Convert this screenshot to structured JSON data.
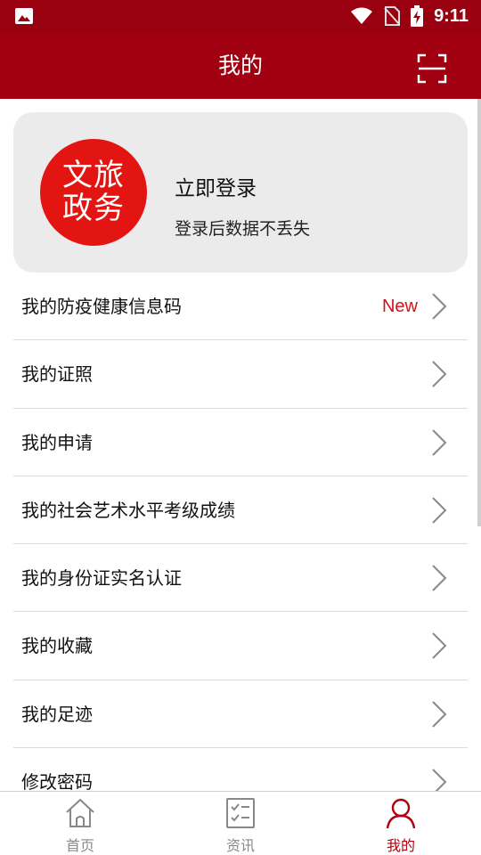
{
  "status_bar": {
    "time": "9:11",
    "icons": [
      "image-icon",
      "wifi-icon",
      "no-sim-icon",
      "battery-charging-icon"
    ]
  },
  "header": {
    "title": "我的",
    "scan_icon": "scan-icon"
  },
  "profile": {
    "logo_line1": "文旅",
    "logo_line2": "政务",
    "login_title": "立即登录",
    "login_subtitle": "登录后数据不丢失"
  },
  "menu": {
    "items": [
      {
        "label": "我的防疫健康信息码",
        "badge": "New"
      },
      {
        "label": "我的证照",
        "badge": ""
      },
      {
        "label": "我的申请",
        "badge": ""
      },
      {
        "label": "我的社会艺术水平考级成绩",
        "badge": ""
      },
      {
        "label": "我的身份证实名认证",
        "badge": ""
      },
      {
        "label": "我的收藏",
        "badge": ""
      },
      {
        "label": "我的足迹",
        "badge": ""
      },
      {
        "label": "修改密码",
        "badge": ""
      }
    ]
  },
  "tabs": [
    {
      "label": "首页",
      "icon": "home-icon",
      "active": false
    },
    {
      "label": "资讯",
      "icon": "news-icon",
      "active": false
    },
    {
      "label": "我的",
      "icon": "user-icon",
      "active": true
    }
  ],
  "colors": {
    "brand": "#a0000f",
    "logo_red": "#e31513",
    "badge_red": "#d6101a",
    "active_tab": "#b0000f"
  }
}
